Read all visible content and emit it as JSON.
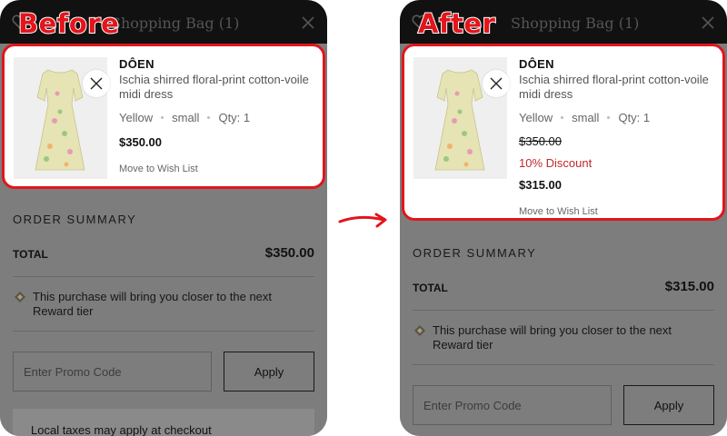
{
  "labels": {
    "before": "Before",
    "after": "After"
  },
  "header": {
    "title": "Shopping Bag (1)"
  },
  "product": {
    "brand": "DÔEN",
    "name": "Ischia shirred floral-print cotton-voile midi dress",
    "color": "Yellow",
    "size": "small",
    "qty": "Qty: 1",
    "move_to_wishlist": "Move to Wish List"
  },
  "before": {
    "price": "$350.00",
    "total": "$350.00"
  },
  "after": {
    "original_price": "$350.00",
    "discount": "10% Discount",
    "price": "$315.00",
    "total": "$315.00"
  },
  "summary": {
    "title": "ORDER SUMMARY",
    "total_label": "TOTAL",
    "reward_text": "This purchase will bring you closer to the next Reward tier",
    "promo_placeholder": "Enter Promo Code",
    "apply_label": "Apply",
    "taxes_text": "Local taxes may apply at checkout"
  },
  "colors": {
    "highlight": "#e3151b",
    "discount": "#c0282b",
    "overlay": "#7d7d7d",
    "header": "#111111"
  },
  "icons": {
    "heart": "heart-icon",
    "close": "close-icon",
    "reward": "diamond-reward-icon",
    "arrow": "right-arrow-icon"
  }
}
